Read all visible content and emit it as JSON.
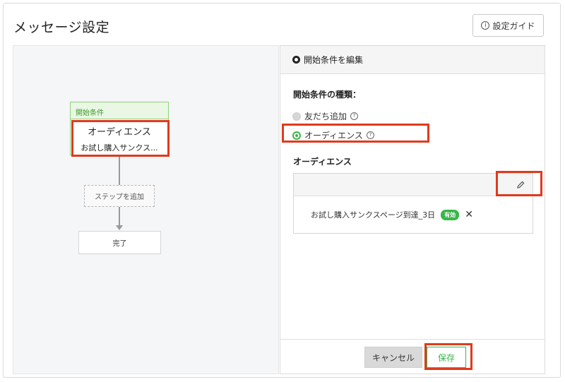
{
  "header": {
    "title": "メッセージ設定",
    "guide_label": "設定ガイド",
    "guide_icon": "info-icon"
  },
  "flow": {
    "start_label": "開始条件",
    "start_name": "オーディエンス",
    "start_sub": "お試し購入サンクス...",
    "add_step_label": "ステップを追加",
    "done_label": "完了"
  },
  "panel": {
    "title": "開始条件を編集",
    "condition_type_label": "開始条件の種類：",
    "options": [
      {
        "label": "友だち追加",
        "selected": false
      },
      {
        "label": "オーディエンス",
        "selected": true
      }
    ],
    "audience_label": "オーディエンス",
    "audience_item": "お試し購入サンクスページ到達_3日",
    "audience_status": "有効",
    "cancel_label": "キャンセル",
    "save_label": "保存"
  },
  "colors": {
    "accent_green": "#3ab54a",
    "highlight_red": "#e03a1c"
  }
}
